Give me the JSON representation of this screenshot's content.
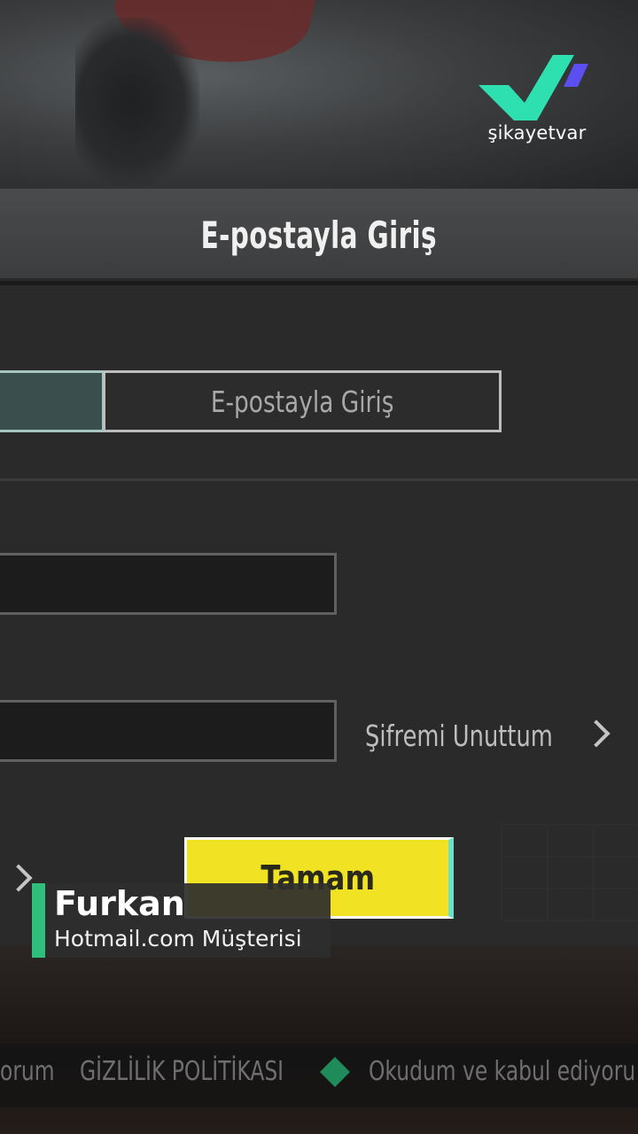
{
  "watermark": {
    "brand": "şikayetvar",
    "colors": {
      "check_primary": "#2ee0b0",
      "check_secondary": "#5b4ff0"
    }
  },
  "header": {
    "title": "E-postayla Giriş"
  },
  "tabs": [
    {
      "label": "",
      "selected": true
    },
    {
      "label": "E-postayla Giriş",
      "selected": false
    }
  ],
  "form": {
    "email": {
      "value": "",
      "placeholder": ""
    },
    "password": {
      "value": "",
      "placeholder": ""
    },
    "forgot_password": "Şifremi Unuttum",
    "ok_button": "Tamam"
  },
  "footer": {
    "left_fragment": "orum",
    "privacy_link": "GİZLİLİK POLİTİKASI",
    "accept_text": "Okudum ve kabul ediyoru"
  },
  "caption": {
    "name": "Furkan",
    "subtitle": "Hotmail.com Müşterisi",
    "accent_color": "#2fbf7d"
  }
}
